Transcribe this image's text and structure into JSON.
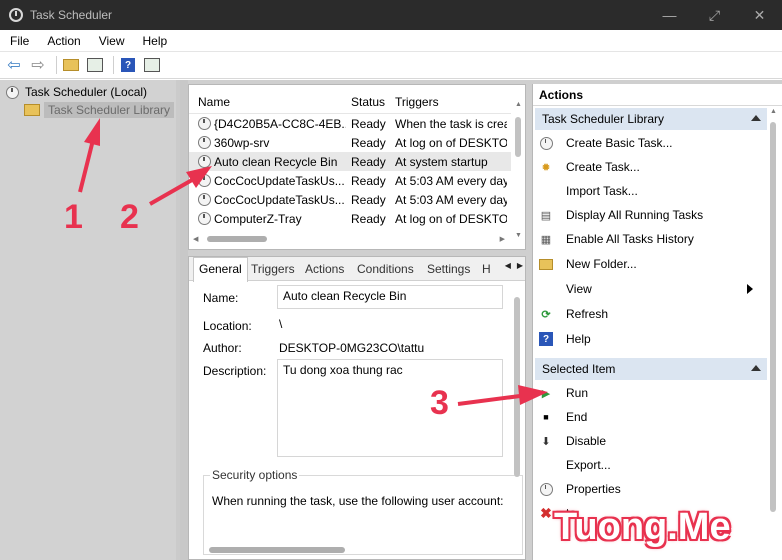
{
  "window": {
    "title": "Task Scheduler",
    "controls": [
      "—",
      "⤢",
      "✕"
    ]
  },
  "menu": [
    "File",
    "Action",
    "View",
    "Help"
  ],
  "tree": {
    "root": "Task Scheduler (Local)",
    "library": "Task Scheduler Library"
  },
  "task_list": {
    "columns": [
      "Name",
      "Status",
      "Triggers"
    ],
    "rows": [
      {
        "name": "{D4C20B5A-CC8C-4EB...",
        "status": "Ready",
        "trigger": "When the task is crea"
      },
      {
        "name": "360wp-srv",
        "status": "Ready",
        "trigger": "At log on of DESKTO"
      },
      {
        "name": "Auto clean Recycle Bin",
        "status": "Ready",
        "trigger": "At system startup"
      },
      {
        "name": "CocCocUpdateTaskUs...",
        "status": "Ready",
        "trigger": "At 5:03 AM every day"
      },
      {
        "name": "CocCocUpdateTaskUs...",
        "status": "Ready",
        "trigger": "At 5:03 AM every day"
      },
      {
        "name": "ComputerZ-Tray",
        "status": "Ready",
        "trigger": "At log on of DESKTO"
      }
    ]
  },
  "details": {
    "tabs": [
      "General",
      "Triggers",
      "Actions",
      "Conditions",
      "Settings",
      "H"
    ],
    "name_label": "Name:",
    "name_value": "Auto clean Recycle Bin",
    "location_label": "Location:",
    "location_value": "\\",
    "author_label": "Author:",
    "author_value": "DESKTOP-0MG23CO\\tattu",
    "description_label": "Description:",
    "description_value": "Tu dong xoa thung rac",
    "security_title": "Security options",
    "security_text": "When running the task, use the following user account:"
  },
  "actions": {
    "title": "Actions",
    "section1": "Task Scheduler Library",
    "items1": [
      "Create Basic Task...",
      "Create Task...",
      "Import Task...",
      "Display All Running Tasks",
      "Enable All Tasks History",
      "New Folder...",
      "View",
      "Refresh",
      "Help"
    ],
    "section2": "Selected Item",
    "items2": [
      "Run",
      "End",
      "Disable",
      "Export...",
      "Properties",
      "te"
    ]
  },
  "annotations": {
    "n1": "1",
    "n2": "2",
    "n3": "3"
  },
  "watermark": "Tuong.Me",
  "colors": {
    "annotation": "#e8324f",
    "section_header": "#dbe5f1",
    "titlebar": "#2b2b2b"
  }
}
